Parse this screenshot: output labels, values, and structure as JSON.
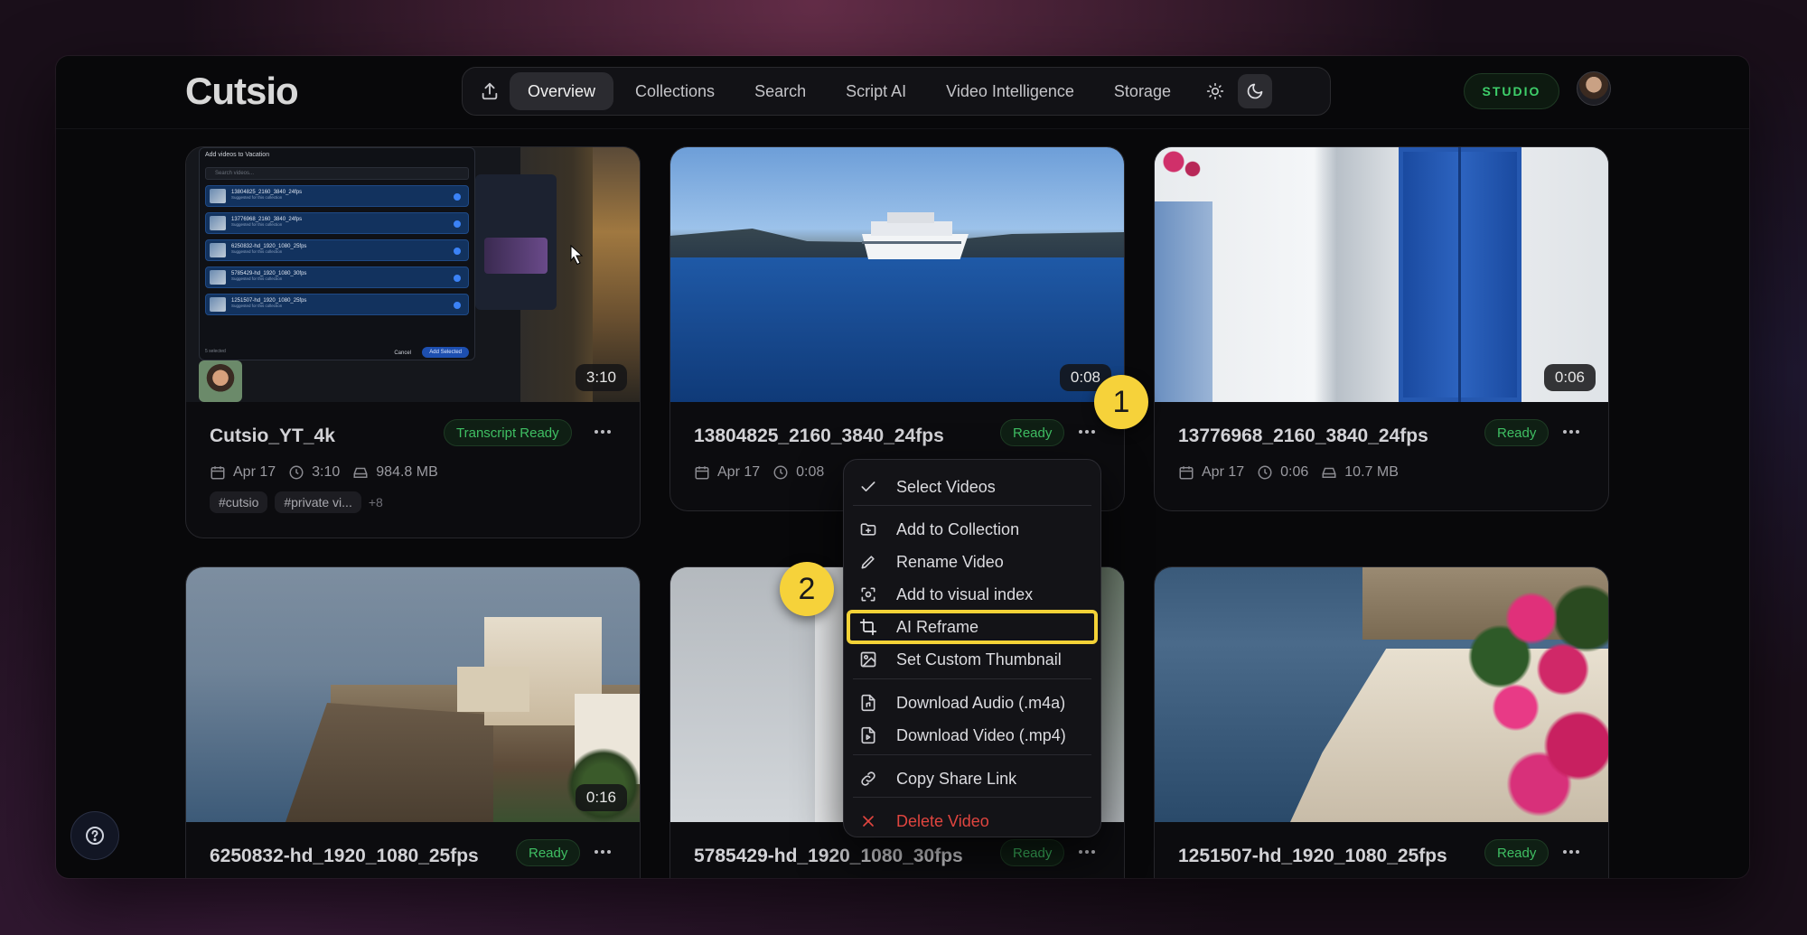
{
  "app": {
    "brand": "Cutsio",
    "studio_label": "STUDIO"
  },
  "nav": {
    "tabs": [
      {
        "label": "Overview",
        "active": true
      },
      {
        "label": "Collections",
        "active": false
      },
      {
        "label": "Search",
        "active": false
      },
      {
        "label": "Script AI",
        "active": false
      },
      {
        "label": "Video Intelligence",
        "active": false
      },
      {
        "label": "Storage",
        "active": false
      }
    ]
  },
  "cards": [
    {
      "title": "Cutsio_YT_4k",
      "status": "Transcript Ready",
      "duration": "3:10",
      "date": "Apr 17",
      "length": "3:10",
      "size": "984.8 MB",
      "tags": [
        "#cutsio",
        "#private vi..."
      ],
      "tags_more": "+8"
    },
    {
      "title": "13804825_2160_3840_24fps",
      "status": "Ready",
      "duration": "0:08",
      "date": "Apr 17",
      "length": "0:08",
      "size": ""
    },
    {
      "title": "13776968_2160_3840_24fps",
      "status": "Ready",
      "duration": "0:06",
      "date": "Apr 17",
      "length": "0:06",
      "size": "10.7 MB"
    },
    {
      "title": "6250832-hd_1920_1080_25fps",
      "status": "Ready",
      "duration": "0:16"
    },
    {
      "title": "5785429-hd_1920_1080_30fps",
      "status": "Ready",
      "duration": ""
    },
    {
      "title": "1251507-hd_1920_1080_25fps",
      "status": "Ready",
      "duration": ""
    }
  ],
  "embedded_dialog": {
    "title": "Add videos to Vacation",
    "search_placeholder": "Search videos...",
    "items": [
      "13804825_2160_3840_24fps",
      "13776968_2160_3840_24fps",
      "6250832-hd_1920_1080_25fps",
      "5785429-hd_1920_1080_30fps",
      "1251507-hd_1920_1080_25fps"
    ],
    "item_sub": "Suggested for this collection",
    "selected_count": "5 selected",
    "cancel": "Cancel",
    "add": "Add Selected"
  },
  "context_menu": {
    "items": [
      {
        "label": "Select Videos",
        "icon": "check-icon"
      },
      {
        "label": "Add to Collection",
        "icon": "folder-plus-icon"
      },
      {
        "label": "Rename Video",
        "icon": "pencil-icon"
      },
      {
        "label": "Add to visual index",
        "icon": "scan-icon"
      },
      {
        "label": "AI Reframe",
        "icon": "crop-icon",
        "highlighted": true
      },
      {
        "label": "Set Custom Thumbnail",
        "icon": "image-icon"
      },
      {
        "label": "Download Audio (.m4a)",
        "icon": "file-audio-icon"
      },
      {
        "label": "Download Video (.mp4)",
        "icon": "file-video-icon"
      },
      {
        "label": "Copy Share Link",
        "icon": "link-icon"
      },
      {
        "label": "Delete Video",
        "icon": "x-icon",
        "danger": true
      }
    ]
  },
  "callouts": [
    "1",
    "2"
  ],
  "colors": {
    "accent_green": "#3fbf63",
    "highlight_yellow": "#f3d237",
    "danger": "#e0453f"
  }
}
